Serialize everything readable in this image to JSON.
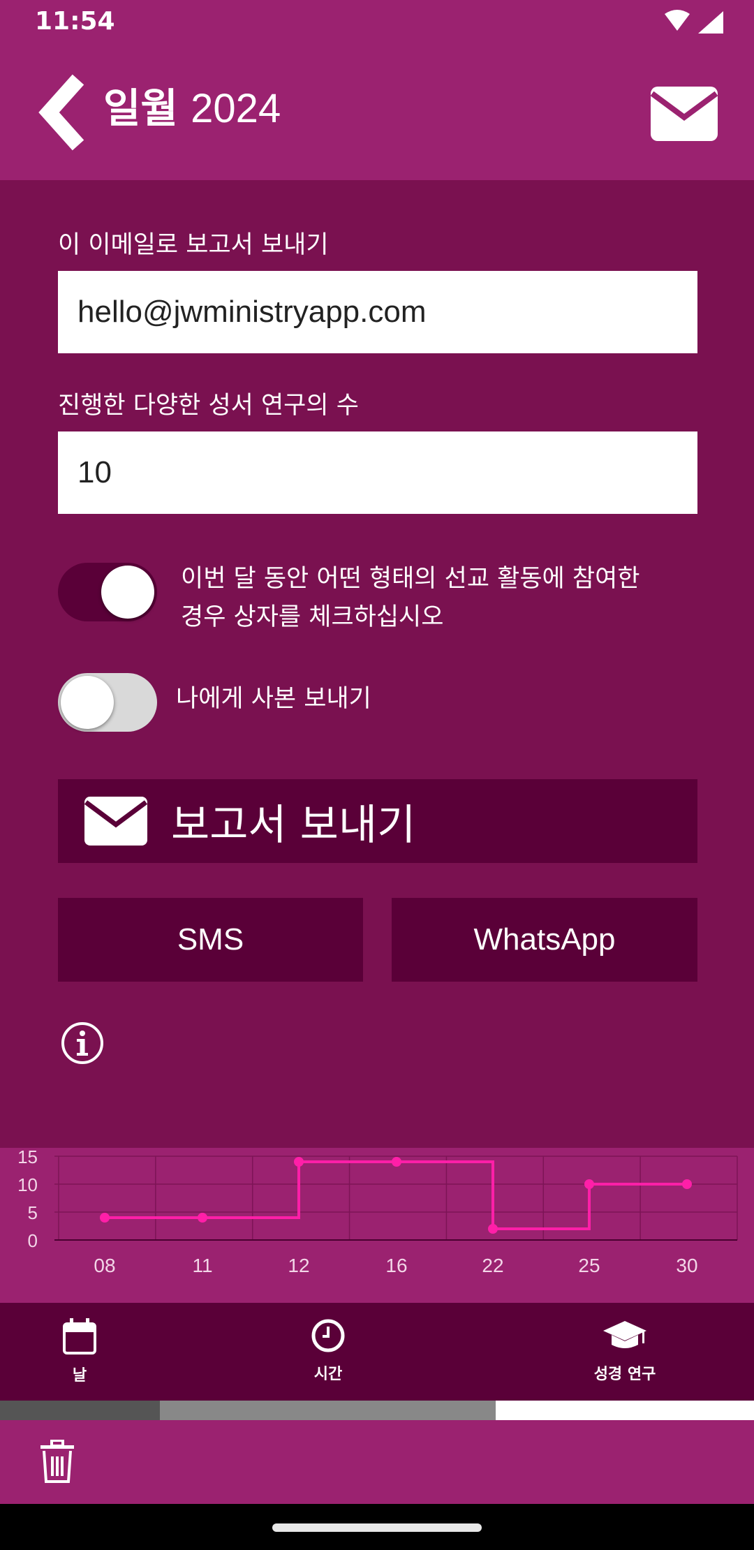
{
  "status": {
    "time": "11:54"
  },
  "header": {
    "month": "일월",
    "year": "2024"
  },
  "form": {
    "email_label": "이 이메일로 보고서 보내기",
    "email_value": "hello@jwministryapp.com",
    "studies_label": "진행한 다양한 성서 연구의 수",
    "studies_value": "10"
  },
  "toggles": {
    "participation_line1": "이번 달 동안 어떤 형태의 선교 활동에 참여한",
    "participation_line2": "경우 상자를 체크하십시오",
    "participation_on": true,
    "copy_label": "나에게 사본 보내기",
    "copy_on": false
  },
  "buttons": {
    "send": "보고서 보내기",
    "sms": "SMS",
    "whatsapp": "WhatsApp"
  },
  "chart_data": {
    "type": "line",
    "step": true,
    "categories": [
      "08",
      "11",
      "12",
      "16",
      "22",
      "25",
      "30"
    ],
    "values": [
      4,
      4,
      14,
      14,
      2,
      10,
      10
    ],
    "ylim": [
      0,
      15
    ],
    "yticks": [
      0,
      5,
      10,
      15
    ],
    "grid": true,
    "color": "#ff1fa8"
  },
  "nav": {
    "days": "날",
    "hours": "시간",
    "studies": "성경 연구"
  },
  "progress": {
    "segments": [
      "#555555",
      "#888888",
      "#ffffff"
    ]
  },
  "colors": {
    "header": "#9b2270",
    "background": "#7a1150",
    "button": "#5a0038",
    "accent": "#ff1fa8"
  }
}
